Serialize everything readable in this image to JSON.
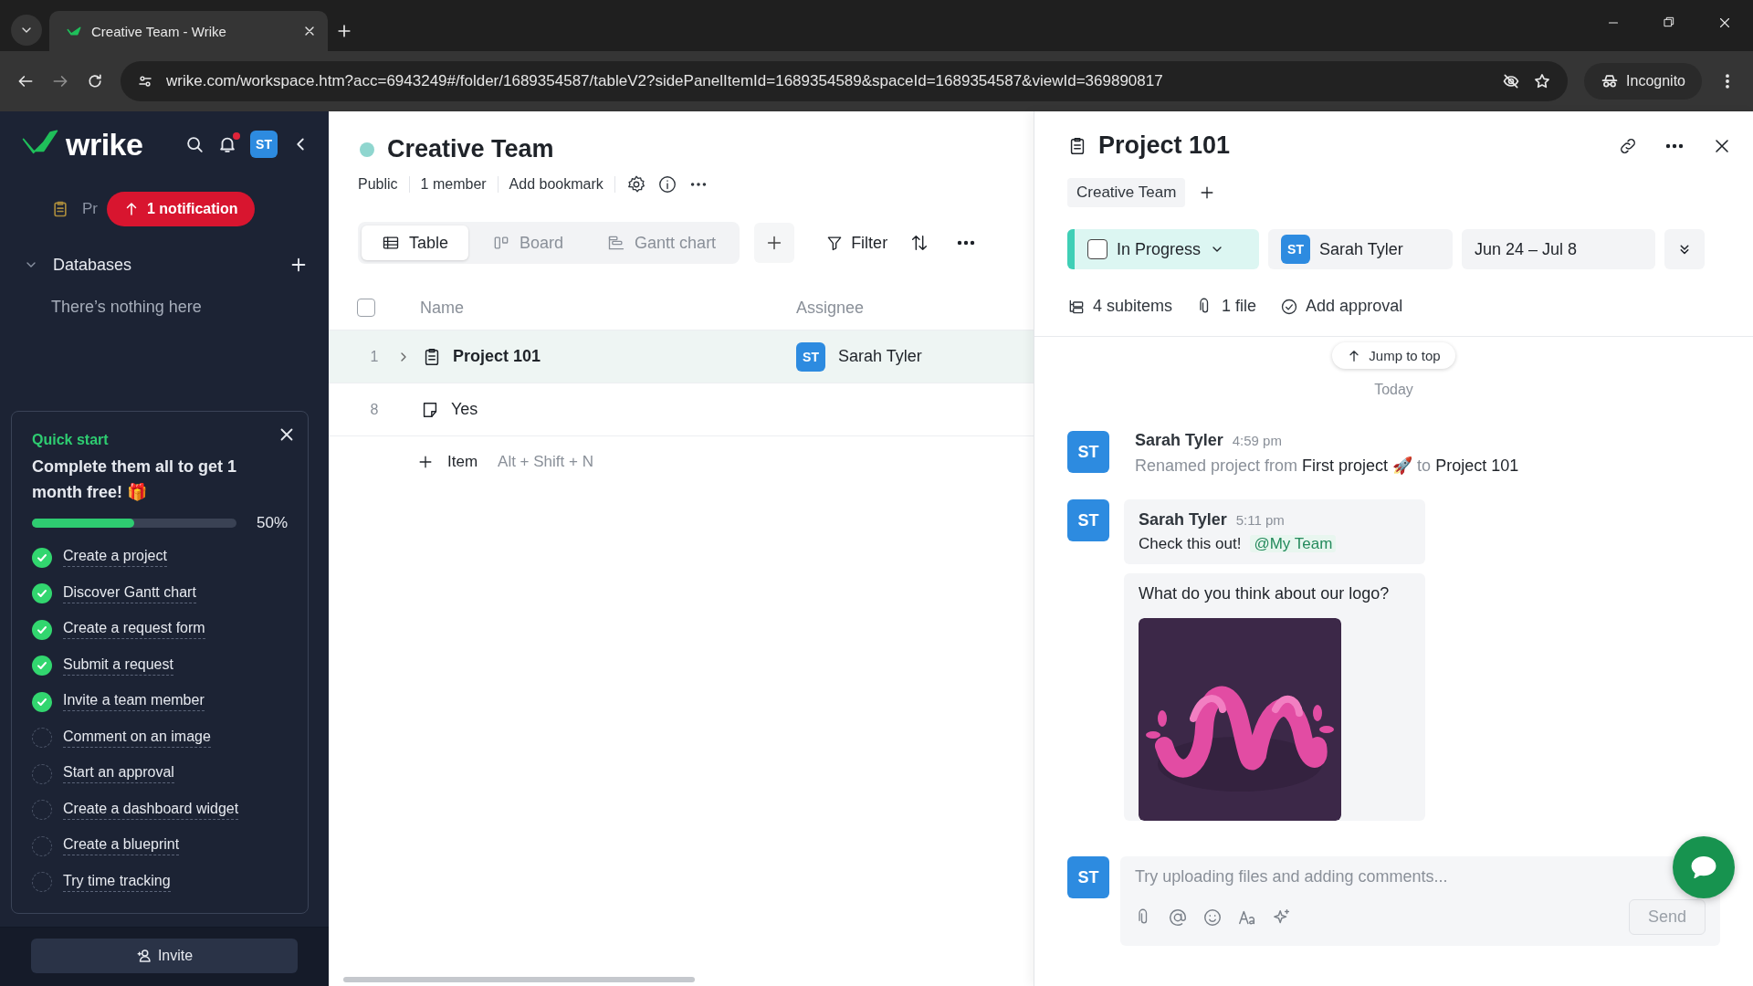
{
  "browser": {
    "tab_title": "Creative Team - Wrike",
    "url": "wrike.com/workspace.htm?acc=6943249#/folder/1689354587/tableV2?sidePanelItemId=1689354589&spaceId=1689354587&viewId=369890817",
    "profile": "Incognito"
  },
  "sidebar": {
    "logo": "wrike",
    "avatar": "ST",
    "notification_badge": "1 notification",
    "partial_item": "Pr",
    "databases": {
      "label": "Databases",
      "expanded": true,
      "empty_text": "There’s nothing here"
    },
    "quick_start": {
      "label": "Quick start",
      "headline": "Complete them all to get 1 month free! 🎁",
      "level": 0.5,
      "percent": "50%",
      "tasks": [
        {
          "label": "Create a project",
          "checked": true
        },
        {
          "label": "Discover Gantt chart",
          "checked": true
        },
        {
          "label": "Create a request form",
          "checked": true
        },
        {
          "label": "Submit a request",
          "checked": true
        },
        {
          "label": "Invite a team member",
          "checked": true
        },
        {
          "label": "Comment on an image",
          "checked": false
        },
        {
          "label": "Start an approval",
          "checked": false
        },
        {
          "label": "Create a dashboard widget",
          "checked": false
        },
        {
          "label": "Create a blueprint",
          "checked": false
        },
        {
          "label": "Try time tracking",
          "checked": false
        }
      ]
    },
    "invite_button": "Invite"
  },
  "main": {
    "title": "Creative Team",
    "meta": [
      "Public",
      "1 member",
      "Add bookmark"
    ],
    "views": [
      {
        "label": "Table",
        "kind": "table",
        "selected": true
      },
      {
        "label": "Board",
        "kind": "board",
        "selected": false
      },
      {
        "label": "Gantt chart",
        "kind": "gantt",
        "selected": false
      }
    ],
    "filter": "Filter",
    "select_all": {
      "checked": false
    },
    "columns": [
      "Name",
      "Assignee"
    ],
    "rows": [
      {
        "number": "1",
        "name": "Project 101",
        "kind": "project",
        "selected": true,
        "assignee": {
          "initials": "ST",
          "name": "Sarah Tyler"
        }
      },
      {
        "number": "8",
        "name": "Yes",
        "kind": "task",
        "selected": false
      }
    ],
    "add_item": {
      "label": "Item",
      "shortcut": "Alt + Shift + N"
    }
  },
  "panel": {
    "title": "Project 101",
    "tags": [
      "Creative Team"
    ],
    "status": {
      "label": "In Progress",
      "color": "#3fcfb6",
      "done": false
    },
    "assignee": {
      "initials": "ST",
      "name": "Sarah Tyler"
    },
    "dates": "Jun 24 – Jul 8",
    "stats": [
      {
        "kind": "subitems",
        "label": "4 subitems"
      },
      {
        "kind": "files",
        "label": "1 file"
      },
      {
        "kind": "approval",
        "label": "Add approval"
      }
    ],
    "jump_to_top": "Jump to top",
    "day_divider": "Today",
    "messages": [
      {
        "kind": "activity",
        "initials": "ST",
        "author": "Sarah Tyler",
        "time": "4:59 pm",
        "text": "Renamed project from **First project 🚀** to **Project 101**"
      },
      {
        "kind": "comment",
        "initials": "ST",
        "author": "Sarah Tyler",
        "time": "5:11 pm",
        "text": "Check this out!",
        "mention": "@My Team",
        "attachment": {
          "caption": "What do you think about our logo?",
          "kind": "picture"
        }
      }
    ],
    "composer": {
      "initials": "ST",
      "placeholder": "Try uploading files and adding comments...",
      "send": "Send",
      "send_disabled": true
    }
  }
}
